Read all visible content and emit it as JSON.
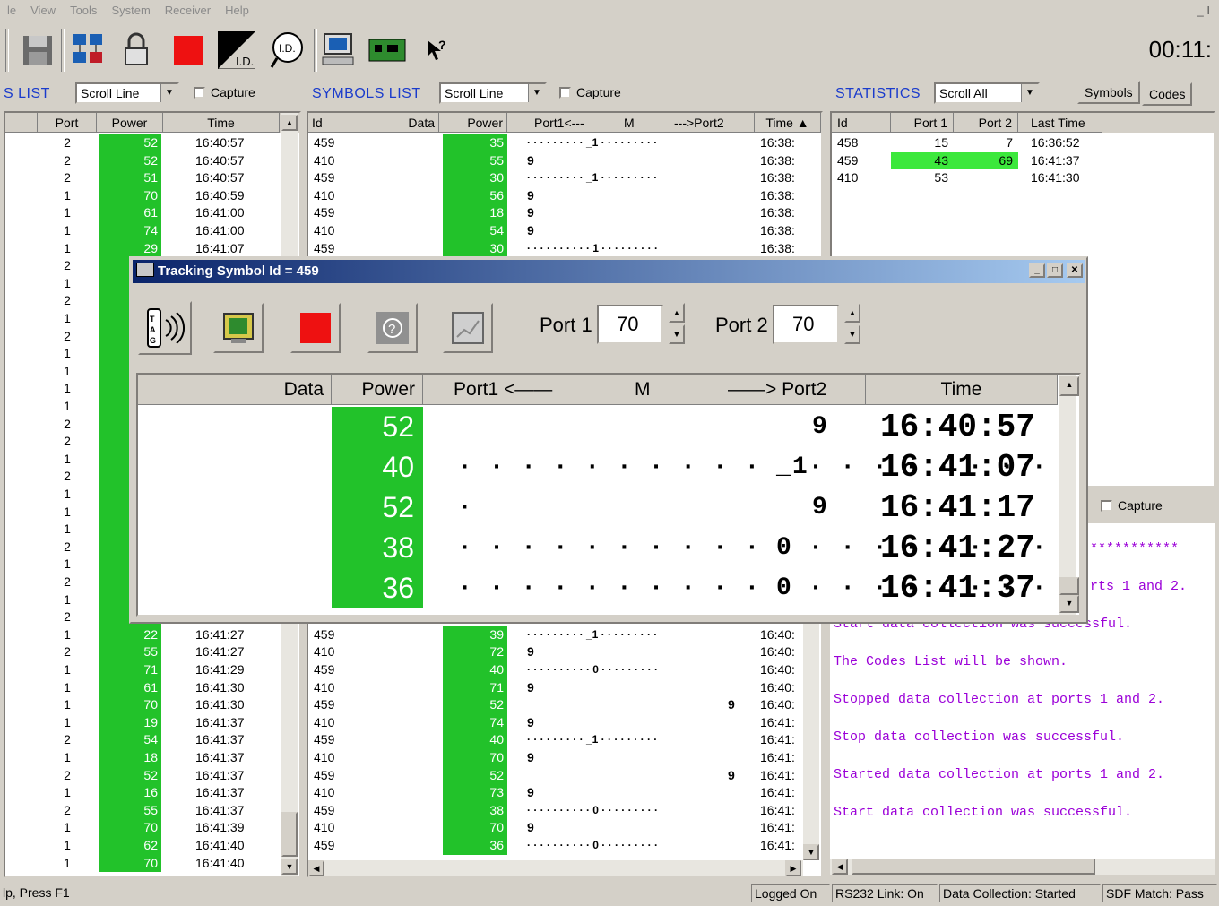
{
  "menu": [
    "le",
    "View",
    "Tools",
    "System",
    "Receiver",
    "Help"
  ],
  "clock": "00:11:",
  "colors": {
    "power_green": "#22c22a",
    "title_blue": "#1a3bcc",
    "log_purple": "#9b00d8",
    "stat_highlight": "#3ce83c"
  },
  "toolbar_icons": [
    "save-icon",
    "network-icon",
    "lock-icon",
    "stop-icon",
    "id-card-icon",
    "id-search-icon",
    "computer-icon",
    "board-icon",
    "help-pointer-icon"
  ],
  "tags_panel": {
    "title": "S LIST",
    "scroll_mode": "Scroll Line",
    "capture_label": "Capture",
    "columns": [
      "Port",
      "Power",
      "Time"
    ],
    "rows": [
      {
        "port": "2",
        "power": "52",
        "time": "16:40:57"
      },
      {
        "port": "2",
        "power": "52",
        "time": "16:40:57"
      },
      {
        "port": "2",
        "power": "51",
        "time": "16:40:57"
      },
      {
        "port": "1",
        "power": "70",
        "time": "16:40:59"
      },
      {
        "port": "1",
        "power": "61",
        "time": "16:41:00"
      },
      {
        "port": "1",
        "power": "74",
        "time": "16:41:00"
      },
      {
        "port": "1",
        "power": "29",
        "time": "16:41:07"
      },
      {
        "port": "2",
        "power": "",
        "time": ""
      },
      {
        "port": "1",
        "power": "",
        "time": ""
      },
      {
        "port": "2",
        "power": "",
        "time": ""
      },
      {
        "port": "1",
        "power": "",
        "time": ""
      },
      {
        "port": "2",
        "power": "",
        "time": ""
      },
      {
        "port": "1",
        "power": "",
        "time": ""
      },
      {
        "port": "1",
        "power": "",
        "time": ""
      },
      {
        "port": "1",
        "power": "",
        "time": ""
      },
      {
        "port": "1",
        "power": "",
        "time": ""
      },
      {
        "port": "2",
        "power": "",
        "time": ""
      },
      {
        "port": "2",
        "power": "",
        "time": ""
      },
      {
        "port": "1",
        "power": "",
        "time": ""
      },
      {
        "port": "2",
        "power": "",
        "time": ""
      },
      {
        "port": "1",
        "power": "",
        "time": ""
      },
      {
        "port": "1",
        "power": "",
        "time": ""
      },
      {
        "port": "1",
        "power": "",
        "time": ""
      },
      {
        "port": "2",
        "power": "",
        "time": ""
      },
      {
        "port": "1",
        "power": "",
        "time": ""
      },
      {
        "port": "2",
        "power": "",
        "time": ""
      },
      {
        "port": "1",
        "power": "",
        "time": ""
      },
      {
        "port": "2",
        "power": "",
        "time": ""
      },
      {
        "port": "1",
        "power": "22",
        "time": "16:41:27"
      },
      {
        "port": "2",
        "power": "55",
        "time": "16:41:27"
      },
      {
        "port": "1",
        "power": "71",
        "time": "16:41:29"
      },
      {
        "port": "1",
        "power": "61",
        "time": "16:41:30"
      },
      {
        "port": "1",
        "power": "70",
        "time": "16:41:30"
      },
      {
        "port": "1",
        "power": "19",
        "time": "16:41:37"
      },
      {
        "port": "2",
        "power": "54",
        "time": "16:41:37"
      },
      {
        "port": "1",
        "power": "18",
        "time": "16:41:37"
      },
      {
        "port": "2",
        "power": "52",
        "time": "16:41:37"
      },
      {
        "port": "1",
        "power": "16",
        "time": "16:41:37"
      },
      {
        "port": "2",
        "power": "55",
        "time": "16:41:37"
      },
      {
        "port": "1",
        "power": "70",
        "time": "16:41:39"
      },
      {
        "port": "1",
        "power": "62",
        "time": "16:41:40"
      },
      {
        "port": "1",
        "power": "70",
        "time": "16:41:40"
      }
    ]
  },
  "symbols_panel": {
    "title": "SYMBOLS LIST",
    "scroll_mode": "Scroll Line",
    "capture_label": "Capture",
    "columns": [
      "Id",
      "Data",
      "Power",
      "Port1<---",
      "M",
      "--->Port2",
      "Time"
    ],
    "rows": [
      {
        "id": "459",
        "power": "35",
        "m": "· · · · · · · · · _1 · · · · · · · · ·",
        "time": "16:38:"
      },
      {
        "id": "410",
        "power": "55",
        "m": "9",
        "time": "16:38:"
      },
      {
        "id": "459",
        "power": "30",
        "m": "· · · · · · · · · _1 · · · · · · · · ·",
        "time": "16:38:"
      },
      {
        "id": "410",
        "power": "56",
        "m": "9",
        "time": "16:38:"
      },
      {
        "id": "459",
        "power": "18",
        "m": "9",
        "time": "16:38:"
      },
      {
        "id": "410",
        "power": "54",
        "m": "9",
        "time": "16:38:"
      },
      {
        "id": "459",
        "power": "30",
        "m": "· · · · · · · · · · 1 · · · · · · · · ·",
        "time": "16:38:"
      },
      {
        "id": "459",
        "power": "39",
        "m": "· · · · · · · · · _1 · · · · · · · · ·",
        "time": "16:40:"
      },
      {
        "id": "410",
        "power": "72",
        "m": "9",
        "time": "16:40:"
      },
      {
        "id": "459",
        "power": "40",
        "m": "· · · · · · · · · · 0 · · · · · · · · ·",
        "time": "16:40:"
      },
      {
        "id": "410",
        "power": "71",
        "m": "9",
        "time": "16:40:"
      },
      {
        "id": "459",
        "power": "52",
        "m": "",
        "m2": "9",
        "time": "16:40:"
      },
      {
        "id": "410",
        "power": "74",
        "m": "9",
        "time": "16:41:"
      },
      {
        "id": "459",
        "power": "40",
        "m": "· · · · · · · · · _1 · · · · · · · · ·",
        "time": "16:41:"
      },
      {
        "id": "410",
        "power": "70",
        "m": "9",
        "time": "16:41:"
      },
      {
        "id": "459",
        "power": "52",
        "m": "",
        "m2": "9",
        "time": "16:41:"
      },
      {
        "id": "410",
        "power": "73",
        "m": "9",
        "time": "16:41:"
      },
      {
        "id": "459",
        "power": "38",
        "m": "· · · · · · · · · · 0 · · · · · · · · ·",
        "time": "16:41:"
      },
      {
        "id": "410",
        "power": "70",
        "m": "9",
        "time": "16:41:"
      },
      {
        "id": "459",
        "power": "36",
        "m": "· · · · · · · · · · 0 · · · · · · · · ·",
        "time": "16:41:"
      }
    ]
  },
  "statistics_panel": {
    "title": "STATISTICS",
    "scroll_mode": "Scroll All",
    "tab_symbols": "Symbols",
    "tab_codes": "Codes",
    "columns": [
      "Id",
      "Port 1",
      "Port 2",
      "Last Time"
    ],
    "rows": [
      {
        "id": "458",
        "p1": "15",
        "p2": "7",
        "time": "16:36:52"
      },
      {
        "id": "459",
        "p1": "43",
        "p2": "69",
        "time": "16:41:37"
      },
      {
        "id": "410",
        "p1": "53",
        "p2": "",
        "time": "16:41:30"
      }
    ]
  },
  "log_panel": {
    "capture_label": "Capture",
    "lines": [
      "***********",
      "rts 1 and 2.",
      "Start data collection was successful.",
      "The Codes List will be shown.",
      "Stopped data collection at ports 1 and 2.",
      "Stop data collection was successful.",
      "Started data collection at ports 1 and 2.",
      "Start data collection was successful."
    ]
  },
  "dialog": {
    "title": "Tracking Symbol Id = 459",
    "port1_label": "Port 1",
    "port1_value": "70",
    "port2_label": "Port 2",
    "port2_value": "70",
    "columns": [
      "Data",
      "Power",
      "Port1 <——",
      "M",
      "——> Port2",
      "Time"
    ],
    "rows": [
      {
        "power": "52",
        "m": "",
        "right": "9",
        "time": "16:40:57"
      },
      {
        "power": "40",
        "m": "· · · · · · · · · · _1· · · · · · · · ·",
        "right": "",
        "time": "16:41:07"
      },
      {
        "power": "52",
        "m": "",
        "right": "9",
        "time": "16:41:17"
      },
      {
        "power": "38",
        "m": "· · · · · · · · · · 0 · · · · · · · · · ·",
        "right": "",
        "time": "16:41:27"
      },
      {
        "power": "36",
        "m": "· · · · · · · · · · 0 · · · · · · · · · ·",
        "right": "",
        "time": "16:41:37"
      }
    ]
  },
  "statusbar": {
    "help": "lp, Press F1",
    "logged": "Logged On",
    "rs232": "RS232 Link: On",
    "collection": "Data Collection: Started",
    "sdf": "SDF Match: Pass"
  }
}
